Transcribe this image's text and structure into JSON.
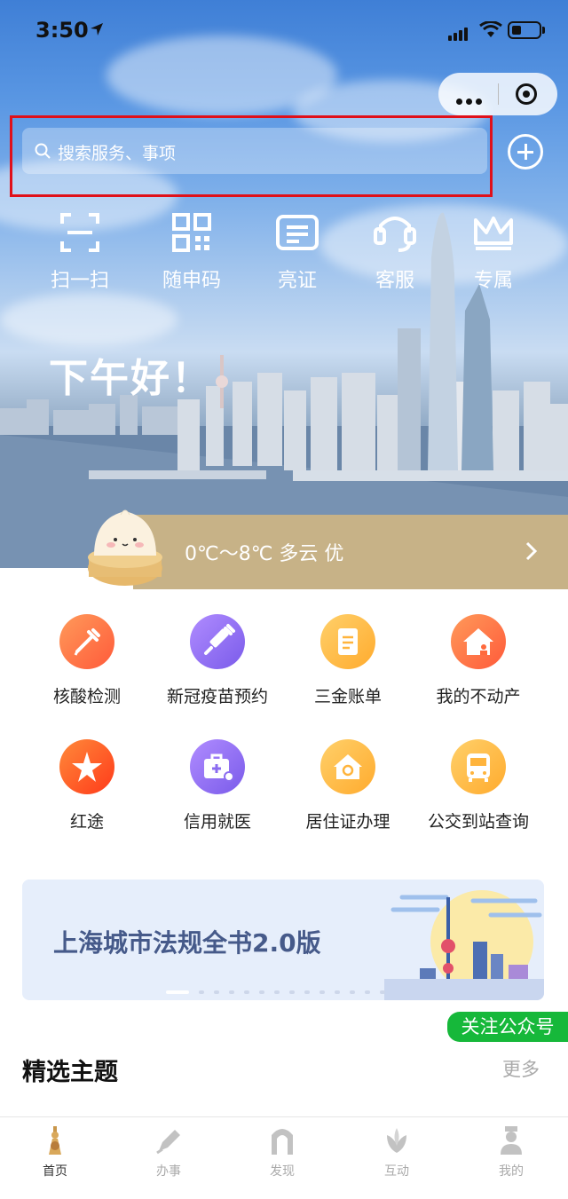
{
  "status_bar": {
    "time": "3:50"
  },
  "search": {
    "placeholder": "搜索服务、事项"
  },
  "quick_actions": [
    {
      "label": "扫一扫",
      "icon": "scan-icon"
    },
    {
      "label": "随申码",
      "icon": "qrcode-icon"
    },
    {
      "label": "亮证",
      "icon": "id-card-icon"
    },
    {
      "label": "客服",
      "icon": "headset-icon"
    },
    {
      "label": "专属",
      "icon": "crown-icon"
    }
  ],
  "greeting": "下午好！",
  "weather": {
    "text": "0℃～8℃  多云  优"
  },
  "services": [
    {
      "label": "核酸检测",
      "icon": "dropper-icon",
      "color": "#ff6a3d"
    },
    {
      "label": "新冠疫苗预约",
      "icon": "syringe-icon",
      "color": "#8b6cf0"
    },
    {
      "label": "三金账单",
      "icon": "bill-icon",
      "color": "#ffb43c"
    },
    {
      "label": "我的不动产",
      "icon": "house-icon",
      "color": "#ff6a3d"
    },
    {
      "label": "红途",
      "icon": "star-icon",
      "color": "#ff5a2a"
    },
    {
      "label": "信用就医",
      "icon": "medical-kit-icon",
      "color": "#8b6cf0"
    },
    {
      "label": "居住证办理",
      "icon": "home-badge-icon",
      "color": "#ffb43c"
    },
    {
      "label": "公交到站查询",
      "icon": "bus-icon",
      "color": "#ffb43c"
    }
  ],
  "banner": {
    "title": "上海城市法规全书2.0版"
  },
  "follow_button": "关注公众号",
  "section": {
    "title": "精选主题",
    "more": "更多"
  },
  "tabbar": [
    {
      "label": "首页",
      "icon": "home-tower-icon",
      "active": true
    },
    {
      "label": "办事",
      "icon": "pen-icon",
      "active": false
    },
    {
      "label": "发现",
      "icon": "arch-icon",
      "active": false
    },
    {
      "label": "互动",
      "icon": "magnolia-icon",
      "active": false
    },
    {
      "label": "我的",
      "icon": "user-icon",
      "active": false
    }
  ]
}
